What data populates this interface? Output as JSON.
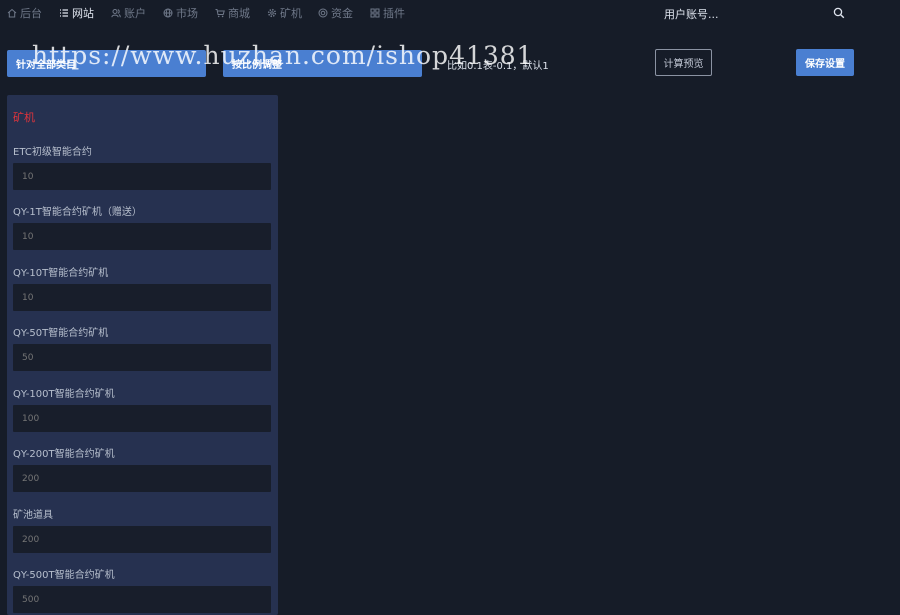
{
  "nav": {
    "items": [
      {
        "label": "后台",
        "icon": "home-icon"
      },
      {
        "label": "网站",
        "icon": "list-icon"
      },
      {
        "label": "账户",
        "icon": "users-icon"
      },
      {
        "label": "市场",
        "icon": "globe-icon"
      },
      {
        "label": "商城",
        "icon": "cart-icon"
      },
      {
        "label": "矿机",
        "icon": "gear-icon"
      },
      {
        "label": "资金",
        "icon": "coin-icon"
      },
      {
        "label": "插件",
        "icon": "grid-icon"
      }
    ],
    "active_label": "网站",
    "account_text": "用户账号...",
    "search_icon": "search-icon"
  },
  "toolbar": {
    "apply_all_label": "针对全部类目",
    "second_button_label": "按比例调整",
    "hint": "比如0.1表-0.1，默认1",
    "calc_preview_label": "计算预览",
    "save_label": "保存设置"
  },
  "watermark": "https://www.huzhan.com/ishop41381",
  "panel": {
    "title": "矿机",
    "title_color": "#e0343c",
    "fields": [
      {
        "label": "ETC初级智能合约",
        "placeholder": "10"
      },
      {
        "label": "QY-1T智能合约矿机（赠送）",
        "placeholder": "10"
      },
      {
        "label": "QY-10T智能合约矿机",
        "placeholder": "10"
      },
      {
        "label": "QY-50T智能合约矿机",
        "placeholder": "50"
      },
      {
        "label": "QY-100T智能合约矿机",
        "placeholder": "100"
      },
      {
        "label": "QY-200T智能合约矿机",
        "placeholder": "200"
      },
      {
        "label": "矿池道具",
        "placeholder": "200"
      },
      {
        "label": "QY-500T智能合约矿机",
        "placeholder": "500"
      }
    ]
  },
  "colors": {
    "background": "#161c28",
    "panel": "#263150",
    "accent": "#4a7fd1",
    "input": "#181e2b"
  }
}
